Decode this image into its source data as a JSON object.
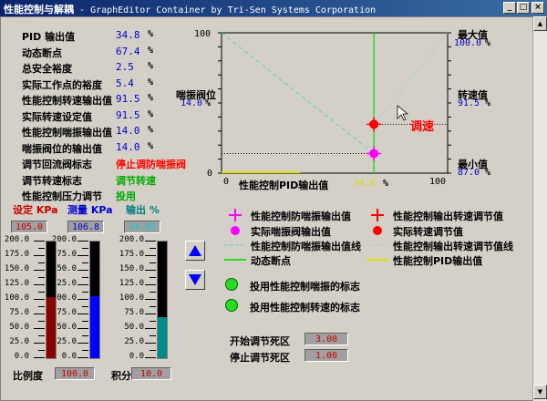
{
  "window": {
    "title_cn": "性能控制与解耦",
    "title_sep": " - ",
    "title_en": "GraphEditor Container by Tri-Sen Systems Corporation"
  },
  "params": [
    {
      "label": "PID 输出值",
      "value": "34.8",
      "unit": "%"
    },
    {
      "label": "动态断点",
      "value": "67.4",
      "unit": "%"
    },
    {
      "label": "总安全裕度",
      "value": "2.5",
      "unit": "%"
    },
    {
      "label": "实际工作点的裕度",
      "value": "5.4",
      "unit": "%"
    },
    {
      "label": "性能控制转速输出值",
      "value": "91.5",
      "unit": "%"
    },
    {
      "label": "实际转速设定值",
      "value": "91.5",
      "unit": "%"
    },
    {
      "label": "性能控制喘振输出值",
      "value": "14.0",
      "unit": "%"
    },
    {
      "label": "喘振阀位的输出值",
      "value": "14.0",
      "unit": "%"
    }
  ],
  "statuses": [
    {
      "label": "调节回流阀标志",
      "value": "停止调防喘振阀",
      "color": "#ff0000"
    },
    {
      "label": "调节转速标志",
      "value": "调节转速",
      "color": "#00aa00"
    },
    {
      "label": "性能控制压力调节",
      "value": "投用",
      "color": "#00aa00"
    }
  ],
  "gauges": {
    "setpoint_label": "设定 KPa",
    "measure_label": "测量 KPa",
    "output_label": "输出 %",
    "setpoint_value": "105.0",
    "measure_value": "106.8",
    "output_value": "34.85",
    "scale": [
      "200.0",
      "175.0",
      "150.0",
      "125.0",
      "100.0",
      "75.0",
      "50.0",
      "25.0",
      "0.0"
    ],
    "setpoint_fill": 0.525,
    "measure_fill": 0.534,
    "output_fill": 0.3485,
    "setpoint_color": "#8b0000",
    "measure_color": "#0000ff",
    "output_color": "#008b8b"
  },
  "pid": {
    "gain_label": "比例度",
    "gain_value": "100.0",
    "integral_label": "积分",
    "integral_value": "10.0"
  },
  "buttons": {
    "up_icon": "triangle-up-icon",
    "down_icon": "triangle-down-icon"
  },
  "chart_data": {
    "type": "line",
    "xlim": [
      0,
      100
    ],
    "ylim": [
      0,
      100
    ],
    "x_ticks": [
      "0",
      "100"
    ],
    "y_ticks": [
      "0",
      "100"
    ],
    "xlabel": "性能控制PID输出值",
    "x_value": "34.8",
    "x_unit": "%",
    "left_axis_label": "喘振阀位",
    "left_axis_value": "14.0",
    "left_axis_unit": "%",
    "right_top_label": "最大值",
    "right_top_value": "100.0",
    "right_top_unit": "%",
    "right_mid_label": "转速值",
    "right_mid_value": "91.5",
    "right_mid_unit": "%",
    "right_bot_label": "最小值",
    "right_bot_value": "87.0",
    "right_bot_unit": "%",
    "annotation": "调速",
    "breakpoint_x": 67.4,
    "surge_line": {
      "x": [
        0,
        67.4
      ],
      "y": [
        100,
        14
      ]
    },
    "speed_line": {
      "x": [
        67.4,
        100
      ],
      "y": [
        34.8,
        100
      ]
    },
    "surge_point": {
      "x": 67.4,
      "y": 14.0
    },
    "speed_point": {
      "x": 67.4,
      "y": 34.8
    },
    "pid_output_x": [
      0,
      34.8
    ]
  },
  "legend": [
    {
      "text": "性能控制防喘振输出值",
      "icon": "magenta-cross-icon"
    },
    {
      "text": "性能控制输出转速调节值",
      "icon": "red-cross-icon"
    },
    {
      "text": "实际喘振阀输出值",
      "icon": "magenta-dot-icon"
    },
    {
      "text": "实际转速调节值",
      "icon": "red-dot-icon"
    },
    {
      "text": "性能控制防喘振输出值线",
      "icon": "cyan-dash-icon"
    },
    {
      "text": "性能控制输出转速调节值线",
      "icon": "dotted-line-icon"
    },
    {
      "text": "动态断点",
      "icon": "green-line-icon"
    },
    {
      "text": "性能控制PID输出值",
      "icon": "yellow-line-icon"
    }
  ],
  "flags": [
    {
      "text": "投用性能控制喘振的标志",
      "color": "#22dd22"
    },
    {
      "text": "投用性能控制转速的标志",
      "color": "#22dd22"
    }
  ],
  "deadband": {
    "start_label": "开始调节死区",
    "start_value": "3.00",
    "stop_label": "停止调节死区",
    "stop_value": "1.00"
  }
}
